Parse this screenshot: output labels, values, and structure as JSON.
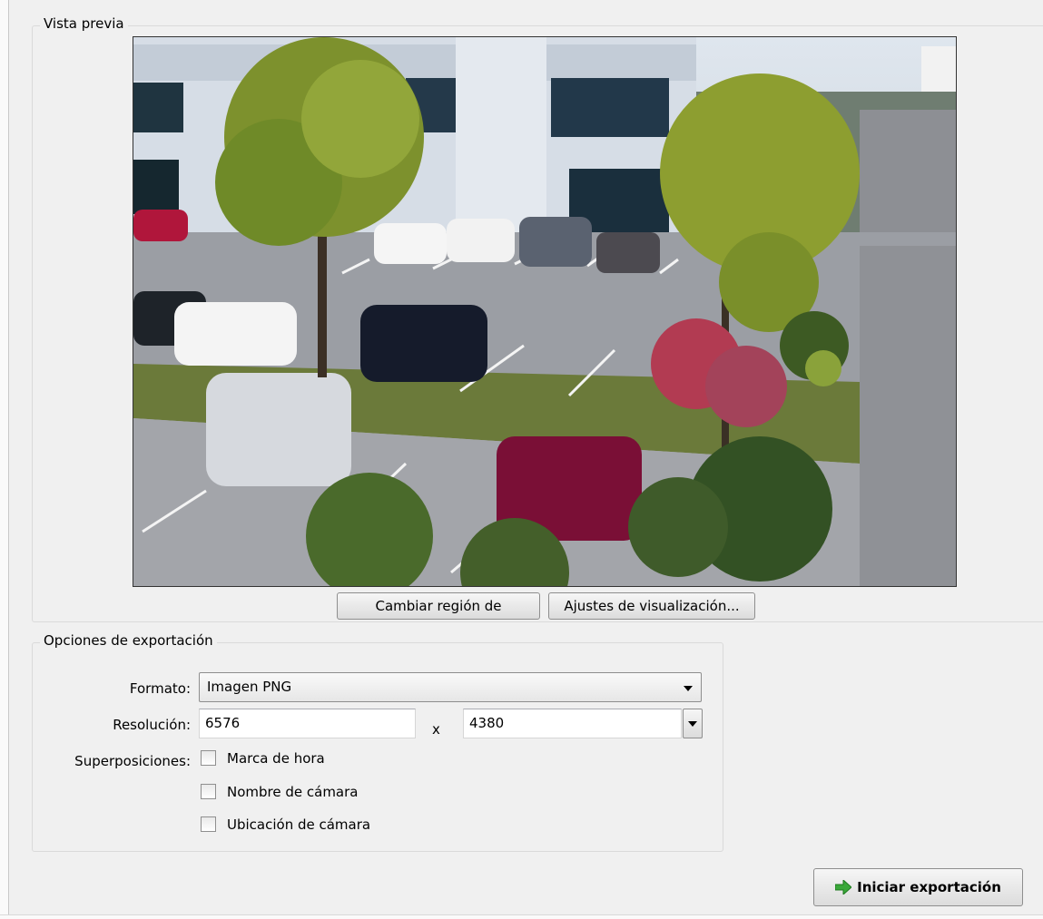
{
  "preview": {
    "title": "Vista previa",
    "change_region_label": "Cambiar región de",
    "display_settings_label": "Ajustes de visualización..."
  },
  "export_options": {
    "title": "Opciones de exportación",
    "format_label": "Formato:",
    "format_value": "Imagen PNG",
    "resolution_label": "Resolución:",
    "resolution_width": "6576",
    "resolution_separator": "x",
    "resolution_height": "4380",
    "overlays_label": "Superposiciones:",
    "overlays": [
      {
        "label": "Marca de hora",
        "checked": false
      },
      {
        "label": "Nombre de cámara",
        "checked": false
      },
      {
        "label": "Ubicación de cámara",
        "checked": false
      }
    ]
  },
  "start_export_label": "Iniciar exportación",
  "colors": {
    "accent_green": "#3aa83a"
  }
}
